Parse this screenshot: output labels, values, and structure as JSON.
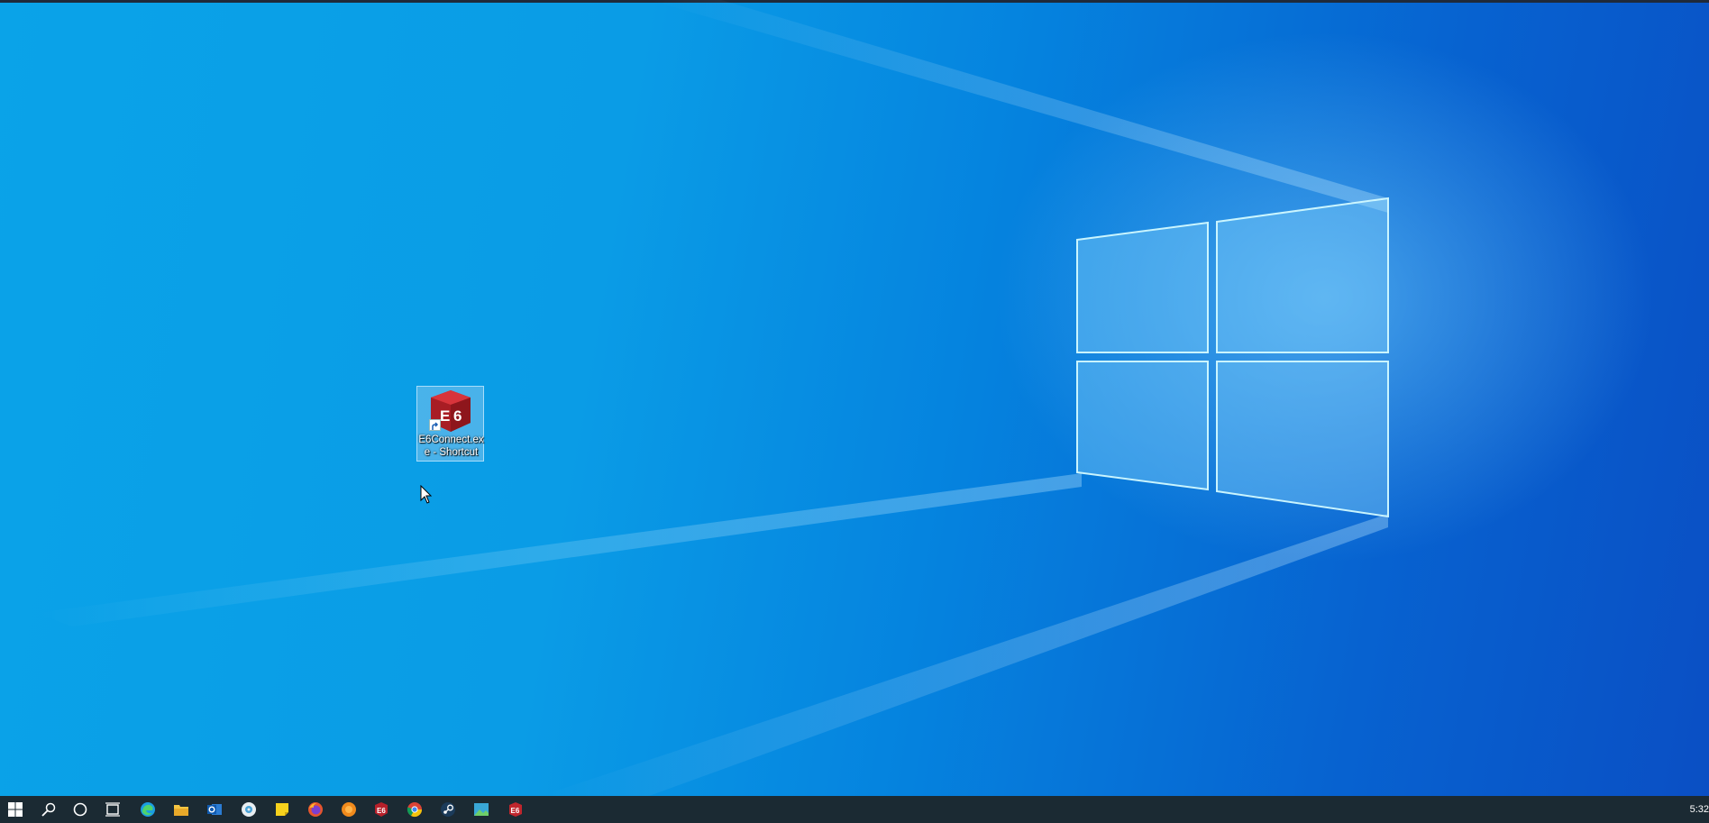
{
  "desktop": {
    "icons": [
      {
        "label": "E6Connect.exe - Shortcut",
        "icon": "e6connect-cube-icon"
      }
    ]
  },
  "taskbar": {
    "buttons": [
      {
        "name": "start-button",
        "icon": "windows-logo-icon"
      },
      {
        "name": "search-button",
        "icon": "search-icon"
      },
      {
        "name": "cortana-button",
        "icon": "cortana-circle-icon"
      },
      {
        "name": "task-view-button",
        "icon": "task-view-icon"
      },
      {
        "name": "edge-button",
        "icon": "edge-icon"
      },
      {
        "name": "file-explorer-button",
        "icon": "folder-icon"
      },
      {
        "name": "outlook-button",
        "icon": "outlook-icon"
      },
      {
        "name": "app-button-1",
        "icon": "settings-app-icon"
      },
      {
        "name": "sticky-notes-button",
        "icon": "sticky-notes-icon"
      },
      {
        "name": "firefox-button",
        "icon": "firefox-icon"
      },
      {
        "name": "app-button-2",
        "icon": "orange-circle-icon"
      },
      {
        "name": "app-button-3",
        "icon": "red-shield-icon"
      },
      {
        "name": "chrome-button",
        "icon": "chrome-icon"
      },
      {
        "name": "steam-button",
        "icon": "steam-icon"
      },
      {
        "name": "app-button-4",
        "icon": "image-app-icon"
      },
      {
        "name": "e6connect-button",
        "icon": "e6connect-cube-icon"
      }
    ],
    "clock": "5:32"
  },
  "colors": {
    "taskbar": "#1b2a33",
    "wallpaper_light": "#0aa3e8",
    "wallpaper_dark": "#0a4fc4",
    "e6_red": "#c0262d"
  }
}
